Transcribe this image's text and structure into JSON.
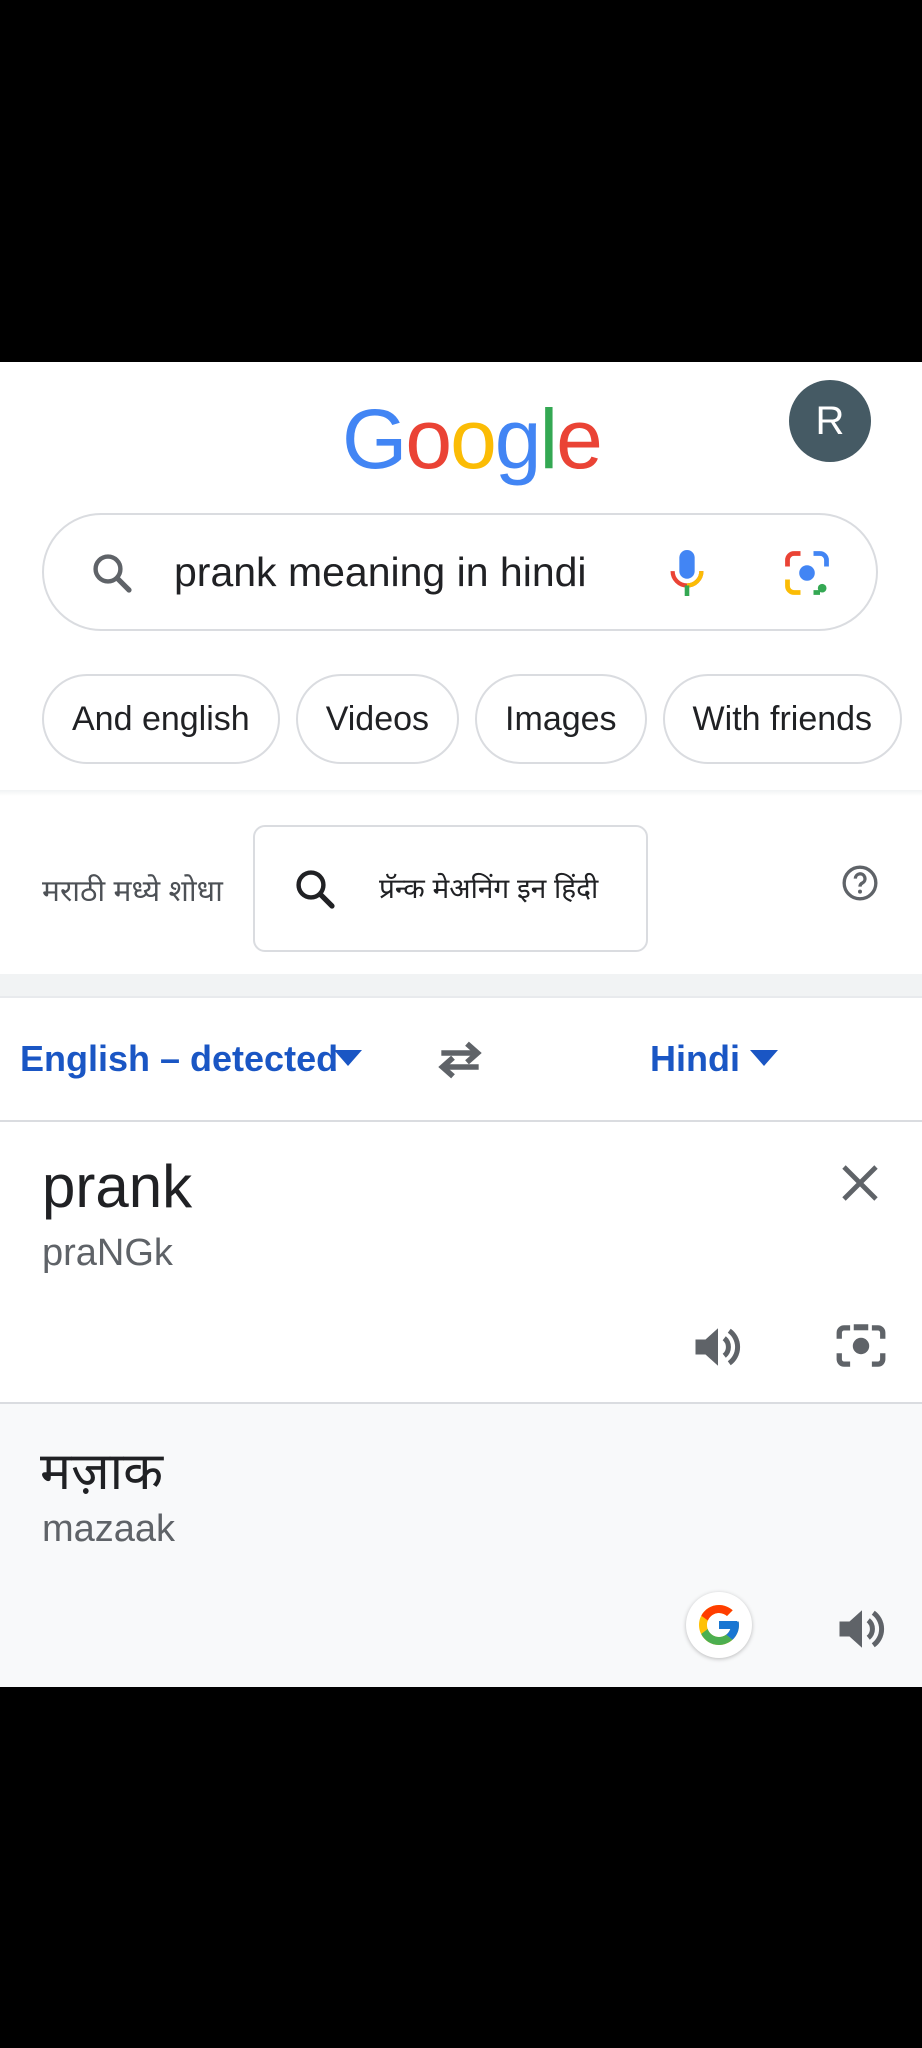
{
  "header": {
    "logo_letters": [
      {
        "char": "G",
        "color": "#4285F4"
      },
      {
        "char": "o",
        "color": "#EA4335"
      },
      {
        "char": "o",
        "color": "#FBBC05"
      },
      {
        "char": "g",
        "color": "#4285F4"
      },
      {
        "char": "l",
        "color": "#34A853"
      },
      {
        "char": "e",
        "color": "#EA4335"
      }
    ],
    "avatar_initial": "R"
  },
  "search": {
    "query": "prank meaning in hindi",
    "icons": [
      "search-icon",
      "mic-icon",
      "google-lens-icon"
    ]
  },
  "chips": [
    "And english",
    "Videos",
    "Images",
    "With friends"
  ],
  "marathi": {
    "label": "मराठी मध्ये शोधा",
    "query": "प्रॅन्क मेअनिंग इन हिंदी"
  },
  "translator": {
    "source_lang": "English – detected",
    "target_lang": "Hindi",
    "source_word": "prank",
    "source_translit": "praNGk",
    "target_word": "मज़ाक",
    "target_translit": "mazaak"
  },
  "colors": {
    "link_blue": "#1a56c4",
    "avatar_bg": "#455a64",
    "icon_gray": "#5f6368"
  }
}
